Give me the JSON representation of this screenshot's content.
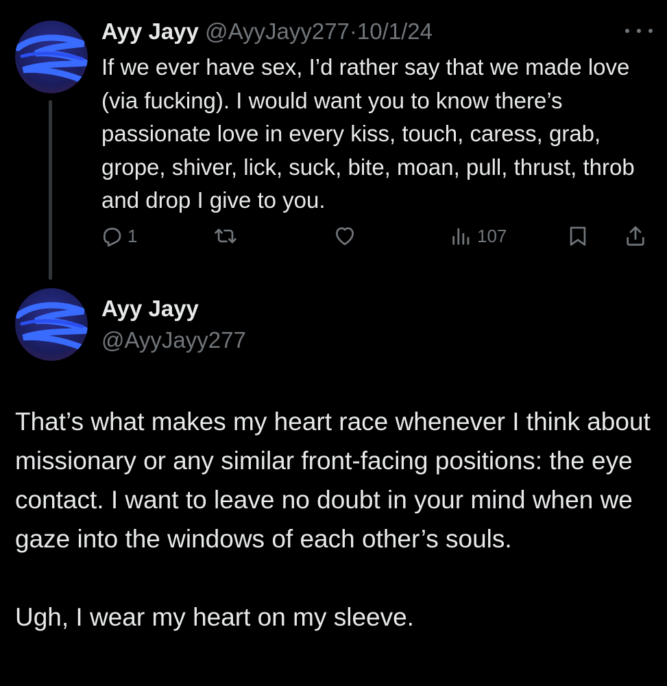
{
  "colors": {
    "background": "#000000",
    "primary_text": "#e7e9ea",
    "secondary_text": "#71767b",
    "thread_line": "#333639",
    "avatar_accent": "#3a4cff"
  },
  "tweet1": {
    "display_name": "Ayy Jayy",
    "handle": "@AyyJayy277",
    "separator": "·",
    "date": "10/1/24",
    "more_icon": "more-horizontal-icon",
    "text": "If we ever have sex, I’d rather say that we made love (via fucking). I would want you to know there’s passionate love in every kiss, touch, caress, grab, grope, shiver, lick, suck, bite, moan, pull, thrust, throb and drop I give to you.",
    "actions": {
      "reply": {
        "icon": "reply-icon",
        "count": "1"
      },
      "retweet": {
        "icon": "retweet-icon",
        "count": ""
      },
      "like": {
        "icon": "heart-icon",
        "count": ""
      },
      "views": {
        "icon": "views-icon",
        "count": "107"
      },
      "bookmark": {
        "icon": "bookmark-icon"
      },
      "share": {
        "icon": "share-icon"
      }
    }
  },
  "tweet2": {
    "display_name": "Ayy Jayy",
    "handle": "@AyyJayy277",
    "paragraphs": [
      "That’s what makes my heart race whenever I think about missionary or any similar front-facing positions: the eye contact. I want to leave no doubt in your mind when we gaze into the windows of each other’s souls.",
      "Ugh, I wear my heart on my sleeve."
    ]
  }
}
